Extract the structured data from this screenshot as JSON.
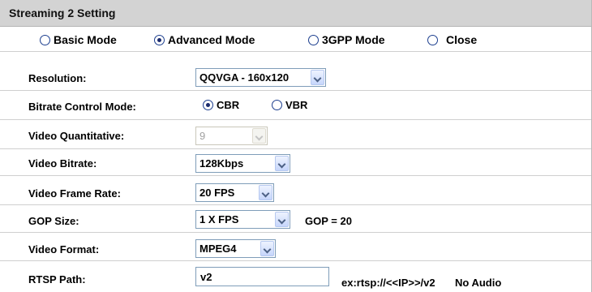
{
  "header": {
    "title": "Streaming 2 Setting"
  },
  "modes": [
    {
      "label": "Basic Mode",
      "checked": false
    },
    {
      "label": "Advanced Mode",
      "checked": true
    },
    {
      "label": "3GPP Mode",
      "checked": false
    },
    {
      "label": "Close",
      "checked": false
    }
  ],
  "resolution": {
    "label": "Resolution:",
    "value": "QQVGA - 160x120"
  },
  "bitrate_mode": {
    "label": "Bitrate Control Mode:",
    "options": [
      {
        "label": "CBR",
        "checked": true
      },
      {
        "label": "VBR",
        "checked": false
      }
    ]
  },
  "quantitative": {
    "label": "Video Quantitative:",
    "value": "9",
    "disabled": true
  },
  "video_bitrate": {
    "label": "Video Bitrate:",
    "value": "128Kbps"
  },
  "frame_rate": {
    "label": "Video Frame Rate:",
    "value": "20 FPS"
  },
  "gop": {
    "label": "GOP Size:",
    "value": "1 X FPS",
    "note": "GOP = 20"
  },
  "video_format": {
    "label": "Video Format:",
    "value": "MPEG4"
  },
  "rtsp": {
    "label": "RTSP Path:",
    "value": "v2",
    "example": "ex:rtsp://<<IP>>/v2",
    "audio_note": "No Audio"
  }
}
